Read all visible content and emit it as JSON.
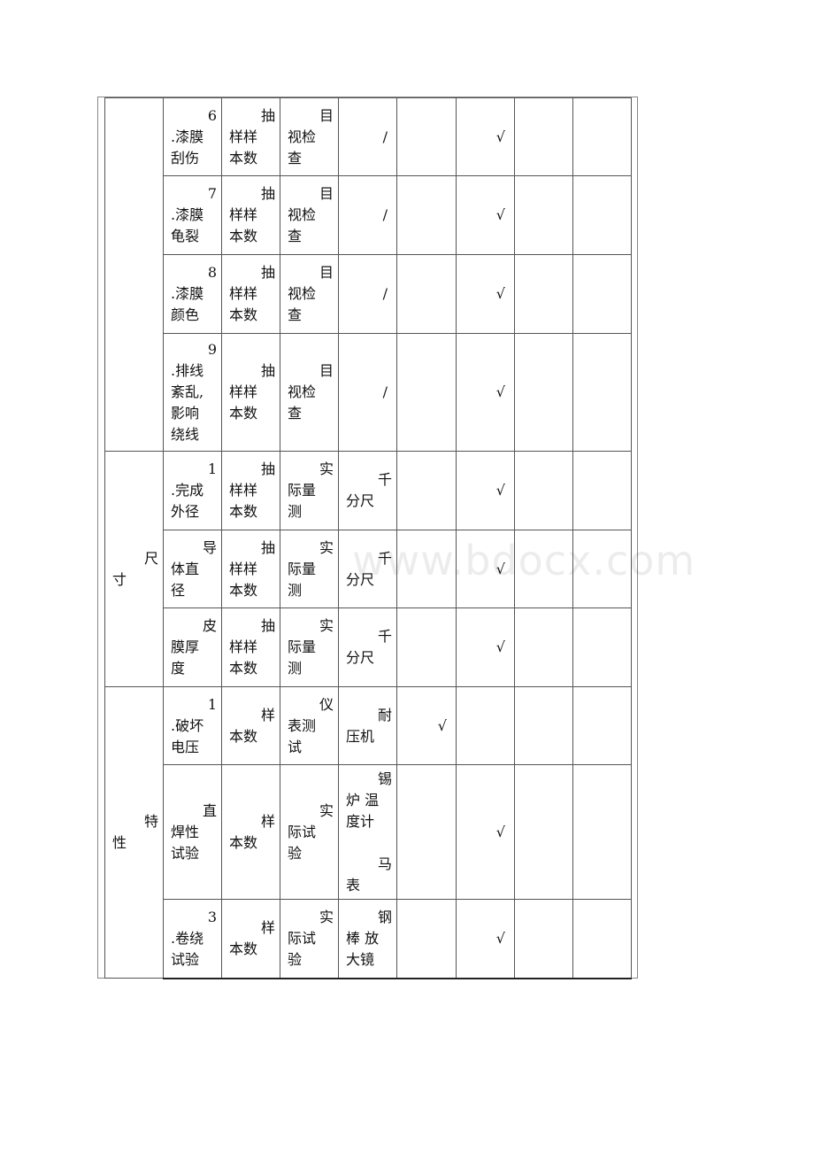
{
  "watermark": "www.bdocx.com",
  "table": {
    "groups": [
      {
        "category": [],
        "rows": [
          {
            "item": [
              "6",
              ".漆膜",
              "刮伤"
            ],
            "sampling": [
              "抽",
              "样样",
              "本数"
            ],
            "method": [
              "目",
              "视检",
              "查"
            ],
            "instrument": [
              "/"
            ],
            "marks": [
              "",
              "√",
              "",
              ""
            ]
          },
          {
            "item": [
              "7",
              ".漆膜",
              "龟裂"
            ],
            "sampling": [
              "抽",
              "样样",
              "本数"
            ],
            "method": [
              "目",
              "视检",
              "查"
            ],
            "instrument": [
              "/"
            ],
            "marks": [
              "",
              "√",
              "",
              ""
            ]
          },
          {
            "item": [
              "8",
              ".漆膜",
              "颜色"
            ],
            "sampling": [
              "抽",
              "样样",
              "本数"
            ],
            "method": [
              "目",
              "视检",
              "查"
            ],
            "instrument": [
              "/"
            ],
            "marks": [
              "",
              "√",
              "",
              ""
            ]
          },
          {
            "item": [
              "9",
              ".排线",
              "紊乱,",
              "影响",
              "绕线"
            ],
            "sampling": [
              "抽",
              "样样",
              "本数"
            ],
            "method": [
              "目",
              "视检",
              "查"
            ],
            "instrument": [
              "/"
            ],
            "marks": [
              "",
              "√",
              "",
              ""
            ]
          }
        ]
      },
      {
        "category": [
          "尺",
          "寸"
        ],
        "rows": [
          {
            "item": [
              "1",
              ".完成",
              "外径"
            ],
            "sampling": [
              "抽",
              "样样",
              "本数"
            ],
            "method": [
              "实",
              "际量",
              "测"
            ],
            "instrument": [
              "千",
              "分尺"
            ],
            "marks": [
              "",
              "√",
              "",
              ""
            ]
          },
          {
            "item": [
              "导",
              "体直",
              "径"
            ],
            "sampling": [
              "抽",
              "样样",
              "本数"
            ],
            "method": [
              "实",
              "际量",
              "测"
            ],
            "instrument": [
              "千",
              "分尺"
            ],
            "marks": [
              "",
              "√",
              "",
              ""
            ]
          },
          {
            "item": [
              "皮",
              "膜厚",
              "度"
            ],
            "sampling": [
              "抽",
              "样样",
              "本数"
            ],
            "method": [
              "实",
              "际量",
              "测"
            ],
            "instrument": [
              "千",
              "分尺"
            ],
            "marks": [
              "",
              "√",
              "",
              ""
            ]
          }
        ]
      },
      {
        "category": [
          "特",
          "性"
        ],
        "rows": [
          {
            "item": [
              "1",
              ".破坏",
              "电压"
            ],
            "sampling": [
              "样",
              "本数"
            ],
            "method": [
              "仪",
              "表测",
              "试"
            ],
            "instrument": [
              "耐",
              "压机"
            ],
            "marks": [
              "√",
              "",
              "",
              ""
            ]
          },
          {
            "item": [
              "直",
              "焊性",
              "试验"
            ],
            "sampling": [
              "样",
              "本数"
            ],
            "method": [
              "实",
              "际试",
              "验"
            ],
            "instrument": [
              "锡",
              "炉 温",
              "度计",
              "",
              "马",
              "表"
            ],
            "marks": [
              "",
              "√",
              "",
              ""
            ]
          },
          {
            "item": [
              "3",
              ".卷绕",
              "试验"
            ],
            "sampling": [
              "样",
              "本数"
            ],
            "method": [
              "实",
              "际试",
              "验"
            ],
            "instrument": [
              "钢",
              "棒 放",
              "大镜"
            ],
            "marks": [
              "",
              "√",
              "",
              ""
            ]
          }
        ]
      }
    ]
  }
}
